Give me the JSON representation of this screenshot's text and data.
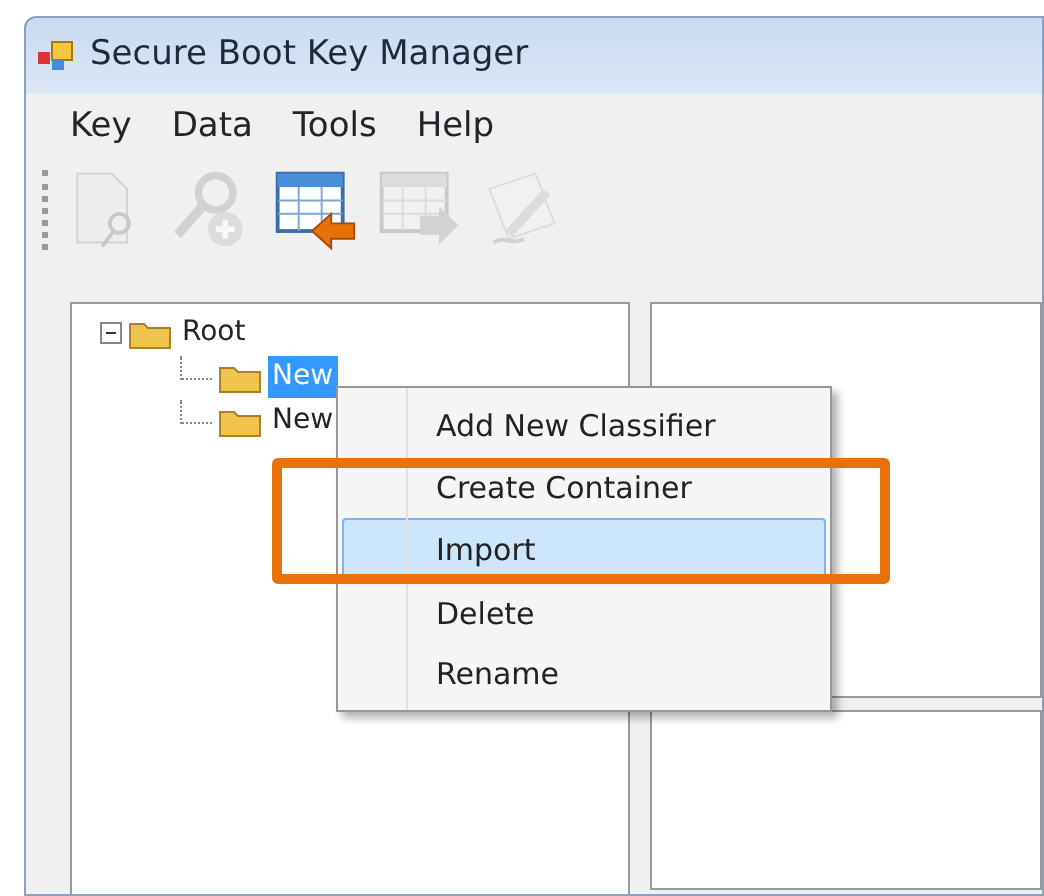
{
  "window": {
    "title": "Secure Boot Key Manager"
  },
  "menu": [
    "Key",
    "Data",
    "Tools",
    "Help"
  ],
  "toolbar": [
    {
      "kind": "key-doc",
      "disabled": true
    },
    {
      "kind": "key-add",
      "disabled": true
    },
    {
      "kind": "table-in",
      "disabled": false
    },
    {
      "kind": "table-out",
      "disabled": true
    },
    {
      "kind": "sign",
      "disabled": true
    }
  ],
  "tree": [
    {
      "label": "Root",
      "expanded": true,
      "selected": false,
      "children": [
        {
          "label": "New",
          "selected": true
        },
        {
          "label": "New",
          "selected": false
        }
      ]
    }
  ],
  "context_menu": [
    {
      "label": "Add New Classifier",
      "selected": false
    },
    {
      "label": "Create Container",
      "selected": false
    },
    {
      "label": "Import",
      "selected": true
    },
    {
      "label": "Delete",
      "selected": false
    },
    {
      "label": "Rename",
      "selected": false
    }
  ],
  "annotation": {
    "color": "#e8710a"
  }
}
